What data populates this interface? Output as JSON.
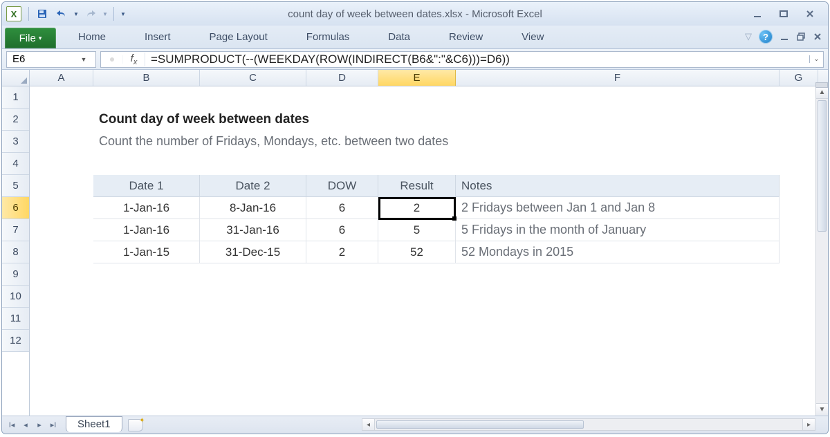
{
  "title": "count day of week between dates.xlsx - Microsoft Excel",
  "ribbon": {
    "file": "File",
    "tabs": [
      "Home",
      "Insert",
      "Page Layout",
      "Formulas",
      "Data",
      "Review",
      "View"
    ]
  },
  "namebox": "E6",
  "formula": "=SUMPRODUCT(--(WEEKDAY(ROW(INDIRECT(B6&\":\"&C6)))=D6))",
  "columns": [
    "A",
    "B",
    "C",
    "D",
    "E",
    "F",
    "G"
  ],
  "selected_col": "E",
  "rows": [
    "1",
    "2",
    "3",
    "4",
    "5",
    "6",
    "7",
    "8",
    "9",
    "10",
    "11",
    "12"
  ],
  "selected_row": "6",
  "content": {
    "heading": "Count day of week between dates",
    "sub": "Count the number of Fridays, Mondays, etc. between two dates",
    "headers": {
      "b": "Date 1",
      "c": "Date 2",
      "d": "DOW",
      "e": "Result",
      "f": "Notes"
    },
    "data": [
      {
        "b": "1-Jan-16",
        "c": "8-Jan-16",
        "d": "6",
        "e": "2",
        "f": "2 Fridays between Jan 1 and Jan 8"
      },
      {
        "b": "1-Jan-16",
        "c": "31-Jan-16",
        "d": "6",
        "e": "5",
        "f": "5 Fridays in the month of January"
      },
      {
        "b": "1-Jan-15",
        "c": "31-Dec-15",
        "d": "2",
        "e": "52",
        "f": "52 Mondays in 2015"
      }
    ]
  },
  "sheet_tab": "Sheet1"
}
